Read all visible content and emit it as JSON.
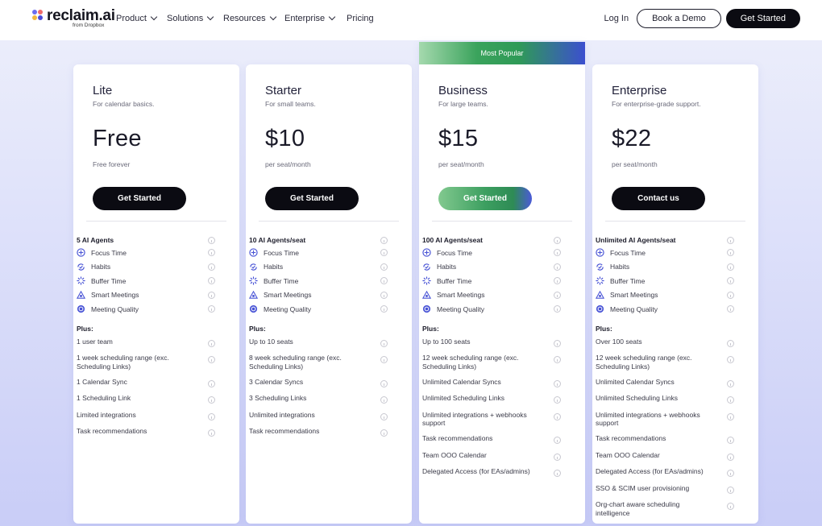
{
  "nav": {
    "brand": "reclaim.ai",
    "brand_sub": "from Dropbox",
    "menu": [
      {
        "label": "Product",
        "dropdown": true
      },
      {
        "label": "Solutions",
        "dropdown": true
      },
      {
        "label": "Resources",
        "dropdown": true
      },
      {
        "label": "Enterprise",
        "dropdown": true
      },
      {
        "label": "Pricing",
        "dropdown": false
      }
    ],
    "login": "Log In",
    "demo": "Book a Demo",
    "get_started": "Get Started"
  },
  "core_features": [
    {
      "label": "Focus Time",
      "icon": "focus-time-icon"
    },
    {
      "label": "Habits",
      "icon": "habits-icon"
    },
    {
      "label": "Buffer Time",
      "icon": "buffer-time-icon"
    },
    {
      "label": "Smart Meetings",
      "icon": "smart-meetings-icon"
    },
    {
      "label": "Meeting Quality",
      "icon": "meeting-quality-icon"
    }
  ],
  "plus_label": "Plus:",
  "plans": [
    {
      "name": "Lite",
      "subtitle": "For calendar basics.",
      "price": "Free",
      "price_note": "Free forever",
      "cta": "Get Started",
      "agents": "5 AI Agents",
      "extras": [
        "1 user team",
        "1 week scheduling range (exc. Scheduling Links)",
        "1 Calendar Sync",
        "1 Scheduling Link",
        "Limited integrations",
        "Task recommendations"
      ]
    },
    {
      "name": "Starter",
      "subtitle": "For small teams.",
      "price": "$10",
      "price_note": "per seat/month",
      "cta": "Get Started",
      "agents": "10 AI Agents/seat",
      "extras": [
        "Up to 10 seats",
        "8 week scheduling range (exc. Scheduling Links)",
        "3 Calendar Syncs",
        "3 Scheduling Links",
        "Unlimited integrations",
        "Task recommendations"
      ]
    },
    {
      "name": "Business",
      "subtitle": "For large teams.",
      "price": "$15",
      "price_note": "per seat/month",
      "cta": "Get Started",
      "badge": "Most Popular",
      "agents": "100 AI Agents/seat",
      "extras": [
        "Up to 100 seats",
        "12 week scheduling range (exc. Scheduling Links)",
        "Unlimited Calendar Syncs",
        "Unlimited Scheduling Links",
        "Unlimited integrations + webhooks support",
        "Task recommendations",
        "Team OOO Calendar",
        "Delegated Access (for EAs/admins)"
      ]
    },
    {
      "name": "Enterprise",
      "subtitle": "For enterprise-grade support.",
      "price": "$22",
      "price_note": "per seat/month",
      "cta": "Contact us",
      "agents": "Unlimited AI Agents/seat",
      "extras": [
        "Over 100 seats",
        "12 week scheduling range (exc. Scheduling Links)",
        "Unlimited Calendar Syncs",
        "Unlimited Scheduling Links",
        "Unlimited integrations + webhooks support",
        "Task recommendations",
        "Team OOO Calendar",
        "Delegated Access (for EAs/admins)",
        "SSO & SCIM user provisioning",
        "Org-chart aware scheduling intelligence"
      ]
    }
  ],
  "colors": {
    "accent_dark": "#0b0b12",
    "green": "#3aa35c",
    "blue": "#3c4fcf",
    "icon_blue": "#4a55d6"
  }
}
